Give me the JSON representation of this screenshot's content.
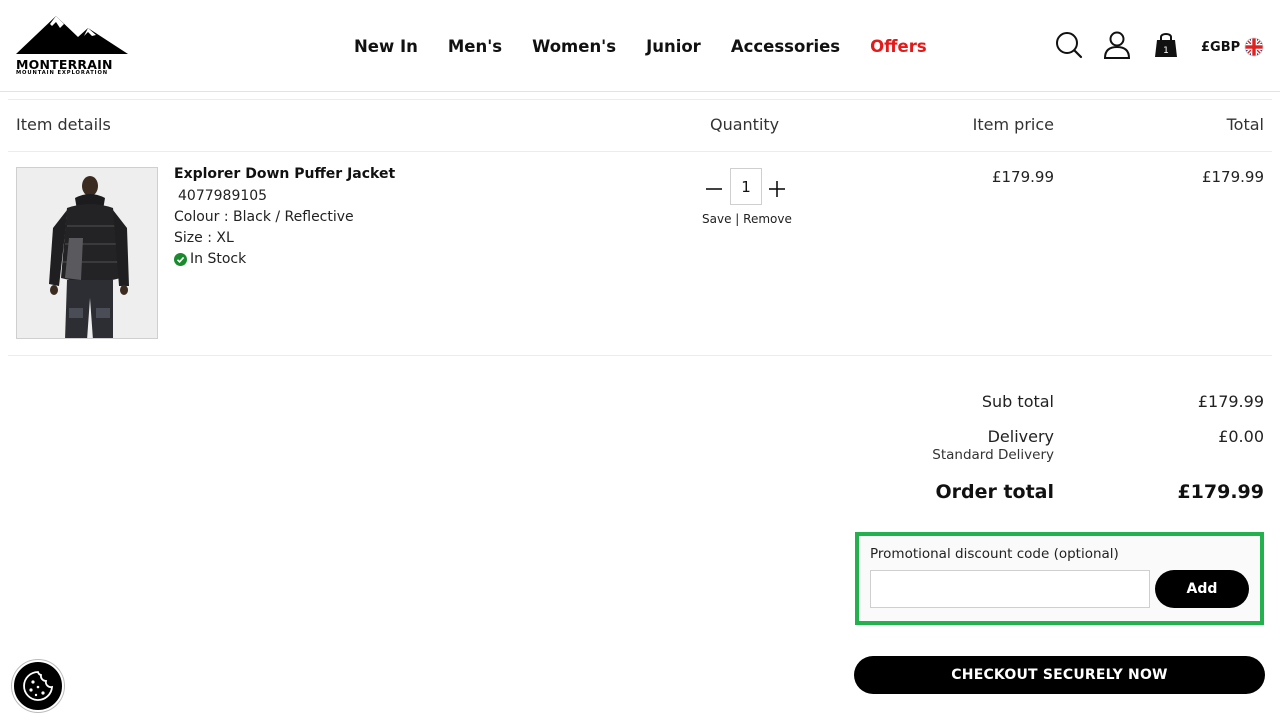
{
  "brand": {
    "name": "MONTERRAIN",
    "tagline": "MOUNTAIN EXPLORATION"
  },
  "nav": {
    "items": [
      {
        "label": "New In"
      },
      {
        "label": "Men's"
      },
      {
        "label": "Women's"
      },
      {
        "label": "Junior"
      },
      {
        "label": "Accessories"
      },
      {
        "label": "Offers",
        "color": "#e21a1a"
      }
    ]
  },
  "header_icons": {
    "search": "search-icon",
    "account": "account-icon",
    "bag": "bag-icon",
    "bag_count": "1",
    "currency": "£GBP",
    "flag": "uk-flag-icon"
  },
  "table": {
    "headers": {
      "item_details": "Item details",
      "quantity": "Quantity",
      "item_price": "Item price",
      "total": "Total"
    }
  },
  "item": {
    "name": "Explorer Down Puffer Jacket",
    "sku": "4077989105",
    "colour": "Colour : Black / Reflective",
    "size": "Size : XL",
    "stock": "In Stock",
    "stock_color": "#1a8a2e",
    "quantity": "1",
    "save_label": "Save",
    "separator": "|",
    "remove_label": "Remove",
    "item_price": "£179.99",
    "total": "£179.99"
  },
  "summary": {
    "subtotal_label": "Sub total",
    "subtotal_value": "£179.99",
    "delivery_label": "Delivery",
    "delivery_value": "£0.00",
    "delivery_method": "Standard Delivery",
    "order_total_label": "Order total",
    "order_total_value": "£179.99"
  },
  "promo": {
    "label": "Promotional discount code (optional)",
    "value": "",
    "add_label": "Add",
    "highlight_color": "#23b14d"
  },
  "checkout": {
    "label": "CHECKOUT SECURELY NOW"
  },
  "cookie": {
    "icon": "cookie-icon"
  }
}
